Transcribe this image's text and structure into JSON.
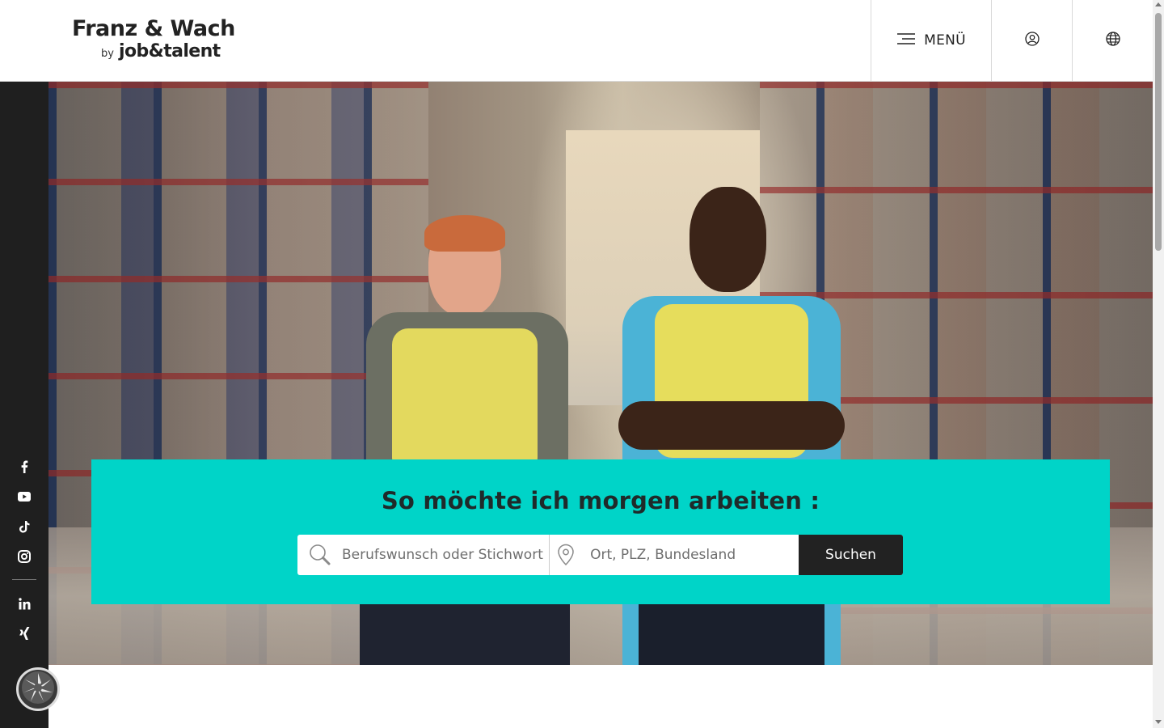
{
  "header": {
    "logo_brand": "Franz & Wach",
    "logo_by": "by",
    "logo_sub": "job&talent",
    "menu_label": "MENÜ"
  },
  "social": {
    "items": [
      "facebook-icon",
      "youtube-icon",
      "tiktok-icon",
      "instagram-icon",
      "linkedin-icon",
      "xing-icon"
    ]
  },
  "search": {
    "title": "So möchte ich morgen arbeiten :",
    "keyword_placeholder": "Berufswunsch oder Stichwort",
    "location_placeholder": "Ort, PLZ, Bundesland",
    "button_label": "Suchen"
  },
  "colors": {
    "accent": "#00d4c8",
    "dark": "#1f1f1f"
  }
}
